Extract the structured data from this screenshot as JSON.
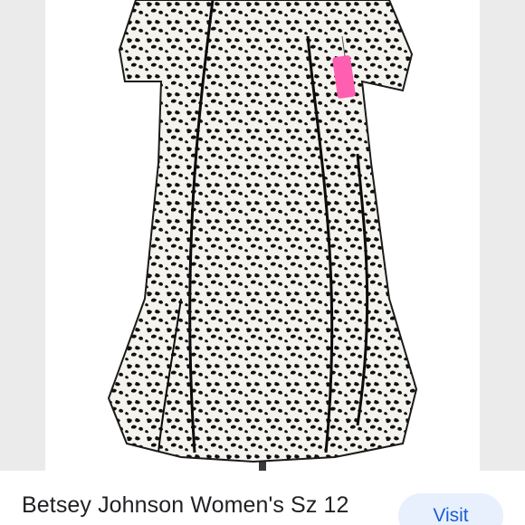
{
  "product": {
    "title": "Betsey Johnson Women's Sz 12",
    "image_subject": "dress-photo"
  },
  "actions": {
    "visit_label": "Visit"
  },
  "colors": {
    "background": "#ebebeb",
    "button_bg": "#e8f0fe",
    "button_text": "#1a5fd0",
    "title_text": "#202124",
    "tag_pink": "#ff5fb0"
  }
}
